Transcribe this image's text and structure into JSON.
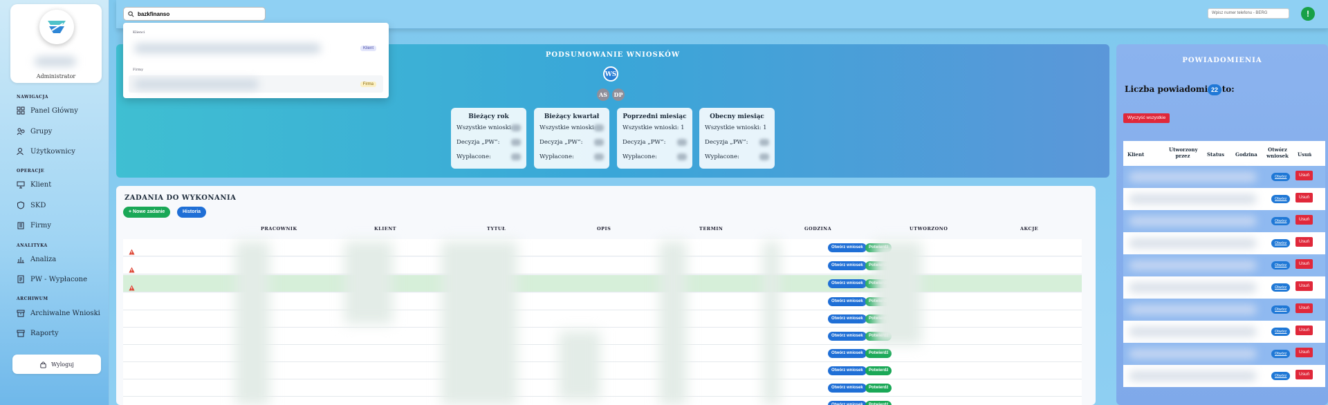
{
  "sidebar": {
    "role": "Administrator",
    "sections": [
      {
        "label": "NAWIGACJA",
        "items": [
          "Panel Główny",
          "Grupy",
          "Użytkownicy"
        ]
      },
      {
        "label": "OPERACJE",
        "items": [
          "Klient",
          "SKD",
          "Firmy"
        ]
      },
      {
        "label": "ANALITYKA",
        "items": [
          "Analiza",
          "PW - Wypłacone"
        ]
      },
      {
        "label": "ARCHIWUM",
        "items": [
          "Archiwalne Wnioski",
          "Raporty"
        ]
      }
    ],
    "logout": "Wyloguj"
  },
  "topbar": {
    "search_value": "bazkfinanso",
    "phone_placeholder": "Wpisz numer telefonu - BERG",
    "alert_icon": "!"
  },
  "dropdown": {
    "group1": "Klienci",
    "badge1": "Klient",
    "group2": "Firmy",
    "badge2": "Firma"
  },
  "summary": {
    "title": "PODSUMOWANIE WNIOSKÓW",
    "avatars": [
      "WS",
      "AS",
      "DP"
    ],
    "cards": [
      {
        "title": "Bieżący rok",
        "all": "Wszystkie wnioski:",
        "pw": "Decyzja „PW”:",
        "paid": "Wypłacone:"
      },
      {
        "title": "Bieżący kwartał",
        "all": "Wszystkie wnioski:",
        "pw": "Decyzja „PW”:",
        "paid": "Wypłacone:"
      },
      {
        "title": "Poprzedni miesiąc",
        "all": "Wszystkie wnioski: 1",
        "pw": "Decyzja „PW”:",
        "paid": "Wypłacone:"
      },
      {
        "title": "Obecny miesiąc",
        "all": "Wszystkie wnioski: 1",
        "pw": "Decyzja „PW”:",
        "paid": "Wypłacone:"
      }
    ]
  },
  "tasks": {
    "title": "ZADANIA DO WYKONANIA",
    "new_task": "+ Nowe zadanie",
    "history": "Historia",
    "columns": [
      "PRACOWNIK",
      "KLIENT",
      "TYTUŁ",
      "OPIS",
      "TERMIN",
      "GODZINA",
      "UTWORZONO",
      "AKCJE"
    ],
    "open_label": "Otwórz wniosek",
    "confirm_label": "Potwierdź"
  },
  "notifications": {
    "title": "POWIADOMIENIA",
    "count_label": "Liczba powiadomień to:",
    "count": "22",
    "clear_all": "Wyczyść wszystkie",
    "columns": [
      "Klient",
      "Utworzony przez",
      "Status",
      "Godzina",
      "Otwórz wniosek",
      "Usuń"
    ],
    "open_label": "Otwórz",
    "delete_label": "Usuń"
  }
}
